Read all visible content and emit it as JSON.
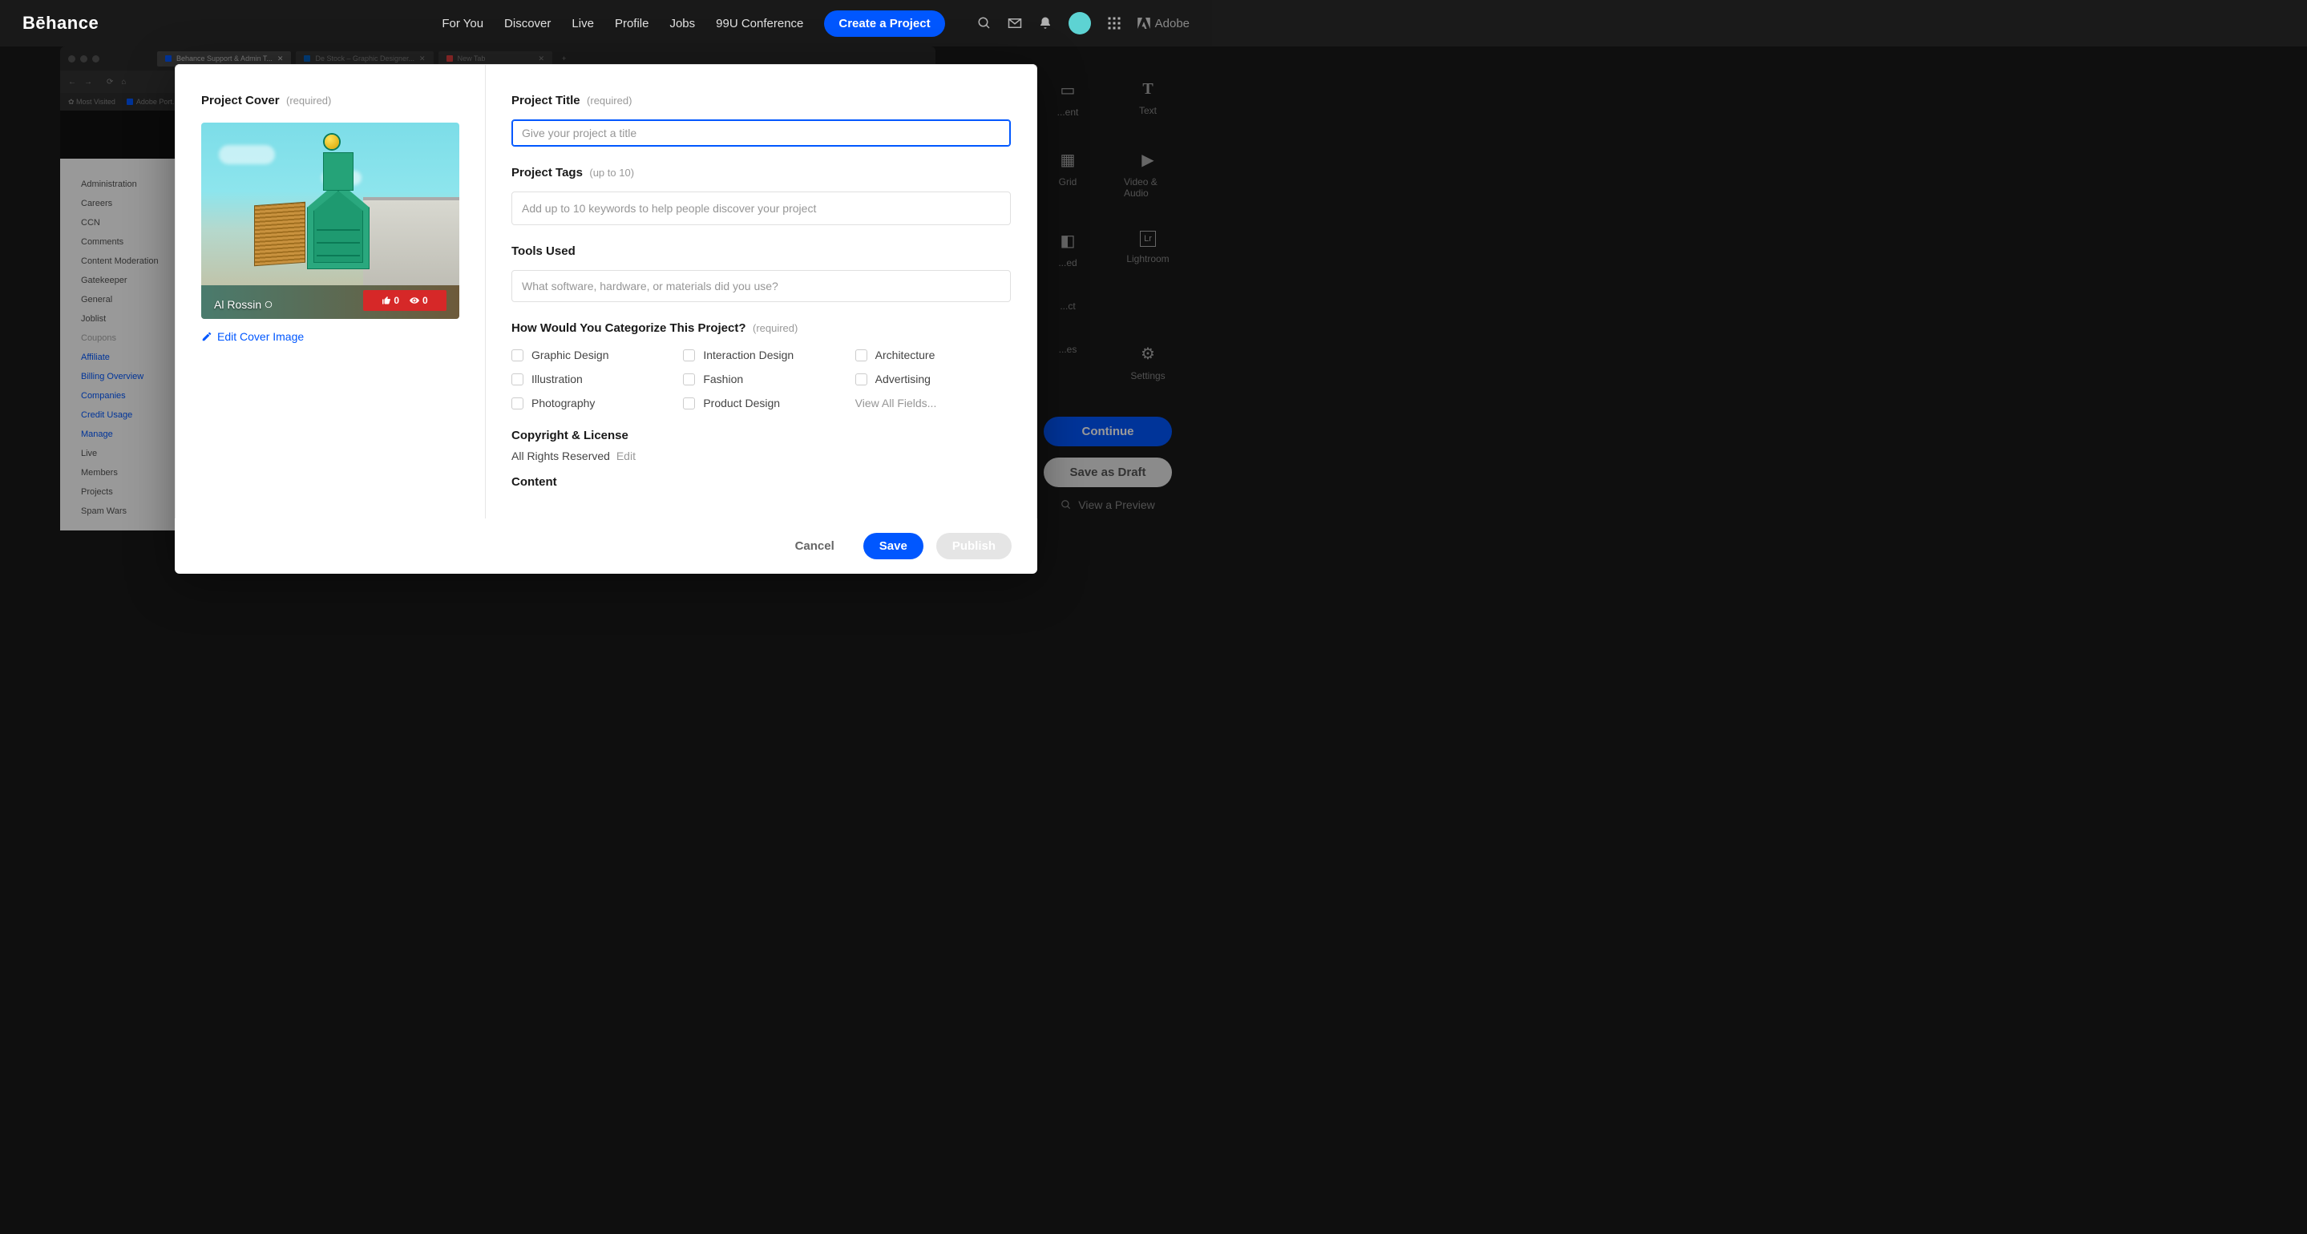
{
  "brand": "Bēhance",
  "nav": {
    "for_you": "For You",
    "discover": "Discover",
    "live": "Live",
    "profile": "Profile",
    "jobs": "Jobs",
    "conference": "99U Conference",
    "create": "Create a Project",
    "adobe": "Adobe"
  },
  "bg_sidebar": {
    "items": [
      {
        "label": "Administration",
        "class": ""
      },
      {
        "label": "Careers",
        "class": ""
      },
      {
        "label": "CCN",
        "class": ""
      },
      {
        "label": "Comments",
        "class": ""
      },
      {
        "label": "Content Moderation",
        "class": ""
      },
      {
        "label": "Gatekeeper",
        "class": ""
      },
      {
        "label": "General",
        "class": ""
      },
      {
        "label": "Joblist",
        "class": ""
      },
      {
        "label": "Coupons",
        "class": "grey"
      },
      {
        "label": "Affiliate",
        "class": "blue"
      },
      {
        "label": "Billing Overview",
        "class": "blue"
      },
      {
        "label": "Companies",
        "class": "blue"
      },
      {
        "label": "Credit Usage",
        "class": "blue"
      },
      {
        "label": "Manage",
        "class": "blue"
      },
      {
        "label": "Live",
        "class": ""
      },
      {
        "label": "Members",
        "class": ""
      },
      {
        "label": "Projects",
        "class": ""
      },
      {
        "label": "Spam Wars",
        "class": ""
      }
    ]
  },
  "right_tools": {
    "row1": [
      {
        "label": "...ent"
      },
      {
        "label": "Text"
      }
    ],
    "row2": [
      {
        "label": "Grid"
      },
      {
        "label": "Video & Audio"
      }
    ],
    "row3": [
      {
        "label": "...ed"
      },
      {
        "label": "Lightroom"
      }
    ],
    "row4": [
      {
        "label": "...ct"
      }
    ],
    "row5": [
      {
        "label": "...es"
      },
      {
        "label": "Settings"
      }
    ]
  },
  "side_buttons": {
    "continue": "Continue",
    "draft": "Save as Draft",
    "preview": "View a Preview"
  },
  "modal": {
    "cover": {
      "label": "Project Cover",
      "required": "(required)",
      "author": "Al Rossin",
      "likes": "0",
      "views": "0",
      "edit": "Edit Cover Image"
    },
    "title": {
      "label": "Project Title",
      "required": "(required)",
      "placeholder": "Give your project a title",
      "value": ""
    },
    "tags": {
      "label": "Project Tags",
      "hint": "(up to 10)",
      "placeholder": "Add up to 10 keywords to help people discover your project"
    },
    "tools": {
      "label": "Tools Used",
      "placeholder": "What software, hardware, or materials did you use?"
    },
    "category": {
      "label": "How Would You Categorize This Project?",
      "required": "(required)",
      "options": [
        "Graphic Design",
        "Interaction Design",
        "Architecture",
        "Illustration",
        "Fashion",
        "Advertising",
        "Photography",
        "Product Design"
      ],
      "view_all": "View All Fields..."
    },
    "copyright": {
      "label": "Copyright & License",
      "value": "All Rights Reserved",
      "edit": "Edit"
    },
    "content": {
      "label": "Content"
    },
    "footer": {
      "cancel": "Cancel",
      "save": "Save",
      "publish": "Publish"
    }
  }
}
